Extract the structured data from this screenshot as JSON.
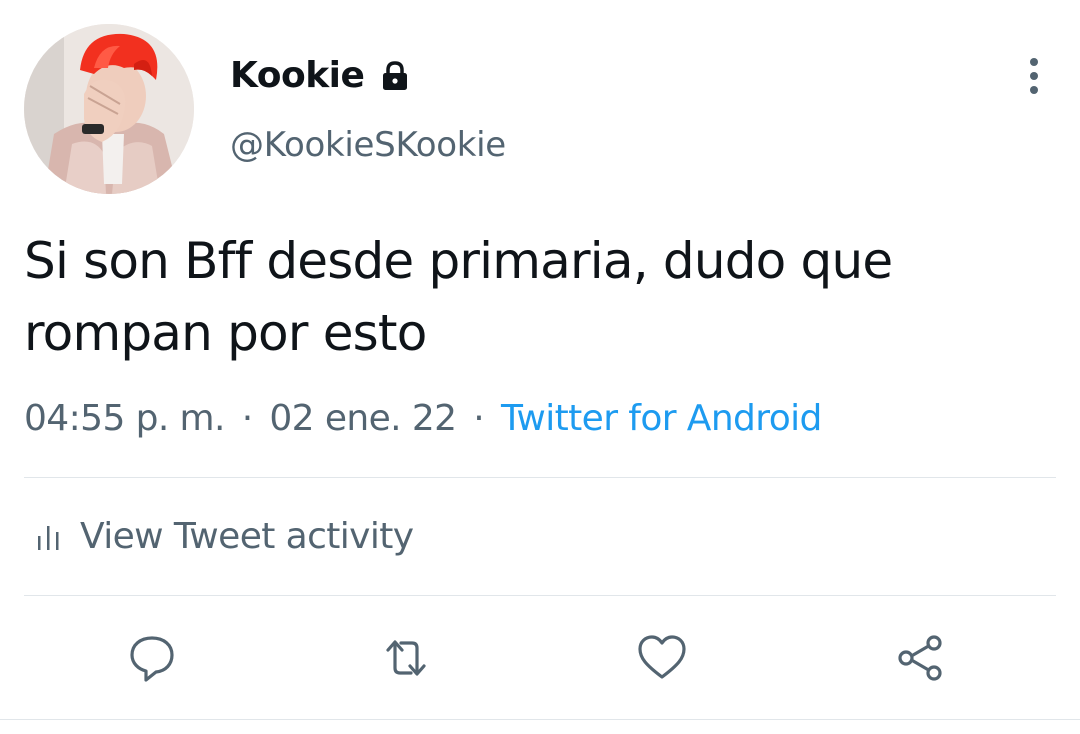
{
  "author": {
    "display_name": "Kookie",
    "handle": "@KookieSKookie",
    "protected_icon": "lock-icon",
    "avatar_icon": "profile-photo"
  },
  "tweet": {
    "text": "Si son Bff desde primaria, dudo que rompan por esto",
    "time": "04:55 p. m.",
    "date": "02 ene. 22",
    "separator": "·",
    "source": "Twitter for Android"
  },
  "activity": {
    "label": "View Tweet activity",
    "icon": "bar-chart-icon"
  },
  "actions": [
    {
      "name": "reply",
      "icon": "speech-bubble-icon"
    },
    {
      "name": "retweet",
      "icon": "retweet-arrows-icon"
    },
    {
      "name": "like",
      "icon": "heart-icon"
    },
    {
      "name": "share",
      "icon": "share-nodes-icon"
    }
  ],
  "menu": {
    "icon": "vertical-dots-icon"
  },
  "colors": {
    "text": "#0f1419",
    "secondary": "#536471",
    "link": "#1d9bf0",
    "divider": "#e1e6ea",
    "hair": "#f2301f"
  }
}
